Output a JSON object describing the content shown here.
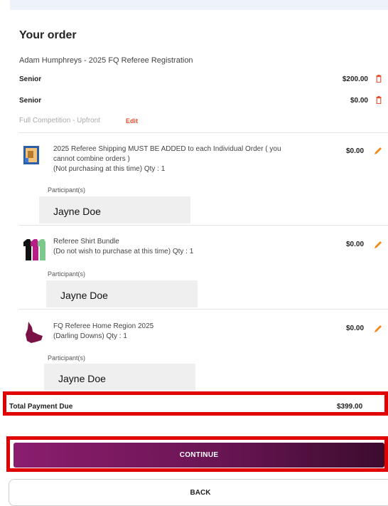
{
  "order": {
    "title": "Your order",
    "subtitle": "Adam Humphreys - 2025 FQ Referee Registration",
    "lines": [
      {
        "label": "Senior",
        "price": "$200.00"
      },
      {
        "label": "Senior",
        "price": "$0.00"
      }
    ],
    "payment_option": "Full Competition - Upfront",
    "edit_label": "Edit"
  },
  "items": [
    {
      "title_lines": [
        "2025 Referee Shipping MUST BE ADDED to each Individual Order ( you",
        "cannot combine orders )",
        "(Not purchasing at this time) Qty : 1"
      ],
      "price": "$0.00",
      "participants_label": "Participant(s)",
      "participant": "Jayne Doe",
      "icon": "shipping-box-icon"
    },
    {
      "title_lines": [
        "Referee Shirt Bundle",
        "(Do not wish to purchase at this time) Qty : 1"
      ],
      "price": "$0.00",
      "participants_label": "Participant(s)",
      "participant": "Jayne Doe",
      "icon": "shirts-icon"
    },
    {
      "title_lines": [
        "FQ Referee Home Region 2025",
        "(Darling Downs) Qty : 1"
      ],
      "price": "$0.00",
      "participants_label": "Participant(s)",
      "participant": "Jayne Doe",
      "icon": "region-map-icon"
    }
  ],
  "total": {
    "label": "Total Payment Due",
    "value": "$399.00"
  },
  "buttons": {
    "continue": "CONTINUE",
    "back": "BACK"
  },
  "colors": {
    "accent_red": "#e84d2c",
    "highlight_red": "#e00000",
    "button_gradient_start": "#8b1d6e",
    "button_gradient_end": "#3c0c2e"
  }
}
